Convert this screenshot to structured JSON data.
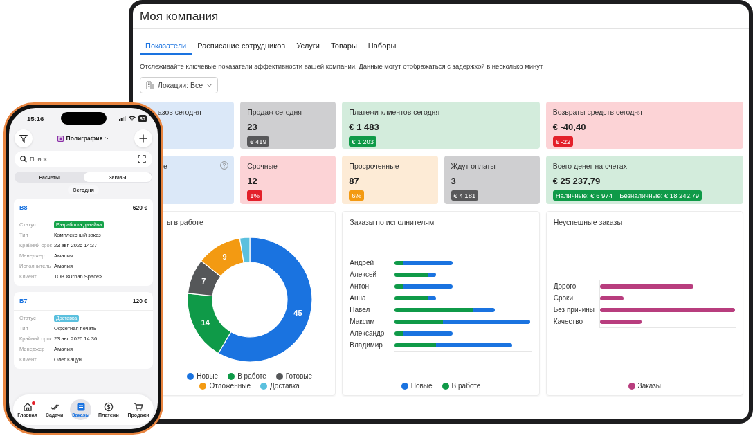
{
  "tablet": {
    "title": "Моя компания",
    "tabs": [
      {
        "label": "Показатели",
        "selected": true
      },
      {
        "label": "Расписание сотрудников",
        "selected": false
      },
      {
        "label": "Услуги",
        "selected": false
      },
      {
        "label": "Товары",
        "selected": false
      },
      {
        "label": "Наборы",
        "selected": false
      }
    ],
    "description": "Отслеживайте ключевые показатели эффективности вашей компании. Данные могут отображаться с задержкой в несколько минут.",
    "location_filter": "Локации: Все",
    "tiles": [
      {
        "title": "азов сегодня",
        "color": "#dbe8f8",
        "wide": false,
        "help": false
      },
      {
        "title": "Продаж сегодня",
        "value": "23",
        "badge": {
          "text": "€ 419",
          "color": "#58585a"
        },
        "color": "#cfcfd1",
        "wide": false,
        "help": false
      },
      {
        "title": "Платежи клиентов сегодня",
        "value": "€ 1 483",
        "badge": {
          "text": "€ 1 203",
          "color": "#0f9a48"
        },
        "color": "#d3ecdc",
        "wide": true,
        "help": false
      },
      {
        "title": "Возвраты средств сегодня",
        "value": "€ -40,40",
        "badge": {
          "text": "€ -22",
          "color": "#e3202a"
        },
        "color": "#fcd3d6",
        "wide": true,
        "help": false
      },
      {
        "title": "е",
        "color": "#dbe8f8",
        "wide": false,
        "help": true
      },
      {
        "title": "Срочные",
        "value": "12",
        "badge": {
          "text": "1%",
          "color": "#e3202a"
        },
        "color": "#fcd3d6",
        "wide": false,
        "help": false
      },
      {
        "title": "Просроченные",
        "value": "87",
        "badge": {
          "text": "6%",
          "color": "#f39a12"
        },
        "color": "#fdebd6",
        "wide": false,
        "help": false
      },
      {
        "title": "Ждут оплаты",
        "value": "3",
        "badge": {
          "text": "€ 4 181",
          "color": "#58585a"
        },
        "color": "#cfcfd1",
        "wide": false,
        "help": false
      },
      {
        "title": "Всего денег на счетах",
        "value": "€ 25 237,79",
        "badge": {
          "text": "Наличные: € 6 974  | Безналичные: € 18 242,79",
          "color": "#0f9a48"
        },
        "color": "#d3ecdc",
        "wide": true,
        "help": false
      }
    ],
    "charts": [
      {
        "kind": "donut",
        "title": "ы в работе",
        "legend": [
          {
            "color": "#1a73e0"
          },
          {
            "color": "#0f9a48"
          },
          {
            "color": "#555759"
          },
          {
            "color": "#f39a12"
          },
          {
            "color": "#5bc0de"
          }
        ],
        "chart_data": {
          "type": "donut",
          "categories": [
            "Новые",
            "В работе",
            "Готовые",
            "Отложенные",
            "Доставка"
          ],
          "values": [
            45,
            14,
            7,
            9,
            2
          ],
          "value_labels": [
            "45",
            "14",
            "7",
            "9",
            null
          ]
        }
      },
      {
        "kind": "stacked_bars",
        "title": "Заказы по исполнителям",
        "labels": [
          "Андрей",
          "Алексей",
          "Антон",
          "Анна",
          "Павел",
          "Максим",
          "Александр",
          "Владимир"
        ],
        "legend": [
          {
            "label": "Новые",
            "color": "#1a73e0"
          },
          {
            "label": "В работе",
            "color": "#0f9a48"
          }
        ]
      },
      {
        "kind": "bars",
        "title": "Неуспешные заказы",
        "labels": [
          "Дорого",
          "Сроки",
          "Без причины",
          "Качество"
        ],
        "legend": [
          {
            "label": "Заказы",
            "color": "#b83d7e"
          }
        ]
      }
    ]
  },
  "phone": {
    "time": "15:16",
    "battery": "80",
    "workspace": "Полиграфия",
    "search": {
      "placeholder": "Поиск"
    },
    "segments": [
      {
        "label": "Расчеты",
        "selected": false
      },
      {
        "label": "Заказы",
        "selected": true
      }
    ],
    "date_chip": "Сегодня",
    "orders": [
      {
        "number": "B8",
        "amount": "620 €",
        "fields": [
          {
            "label": "Статус",
            "value": "Разработка дизайна",
            "kind": "status",
            "color": "#16a34a"
          },
          {
            "label": "Тип",
            "value": "Комплексный заказ",
            "kind": "text"
          },
          {
            "label": "Крайний срок",
            "value": "23 авг. 2026 14:37",
            "kind": "text"
          },
          {
            "label": "Менеджер",
            "value": "Амалия",
            "kind": "text"
          },
          {
            "label": "Исполнитель",
            "value": "Амалия",
            "kind": "text"
          },
          {
            "label": "Клиент",
            "value": "ТОВ «Urban Space»",
            "kind": "text"
          }
        ]
      },
      {
        "number": "B7",
        "amount": "120 €",
        "fields": [
          {
            "label": "Статус",
            "value": "Доставка",
            "kind": "status",
            "color": "#5bc0de"
          },
          {
            "label": "Тип",
            "value": "Офсетная печать",
            "kind": "text"
          },
          {
            "label": "Крайний срок",
            "value": "23 авг. 2026 14:36",
            "kind": "text"
          },
          {
            "label": "Менеджер",
            "value": "Амалия",
            "kind": "text"
          },
          {
            "label": "Клиент",
            "value": "Олег Кацун",
            "kind": "text"
          }
        ]
      }
    ],
    "nav": [
      {
        "label": "Главная",
        "selected": false,
        "notification": true
      },
      {
        "label": "Задачи",
        "selected": false,
        "notification": false
      },
      {
        "label": "Заказы",
        "selected": true,
        "notification": false
      },
      {
        "label": "Платежи",
        "selected": false,
        "notification": false
      },
      {
        "label": "Продажи",
        "selected": false,
        "notification": false
      }
    ]
  }
}
